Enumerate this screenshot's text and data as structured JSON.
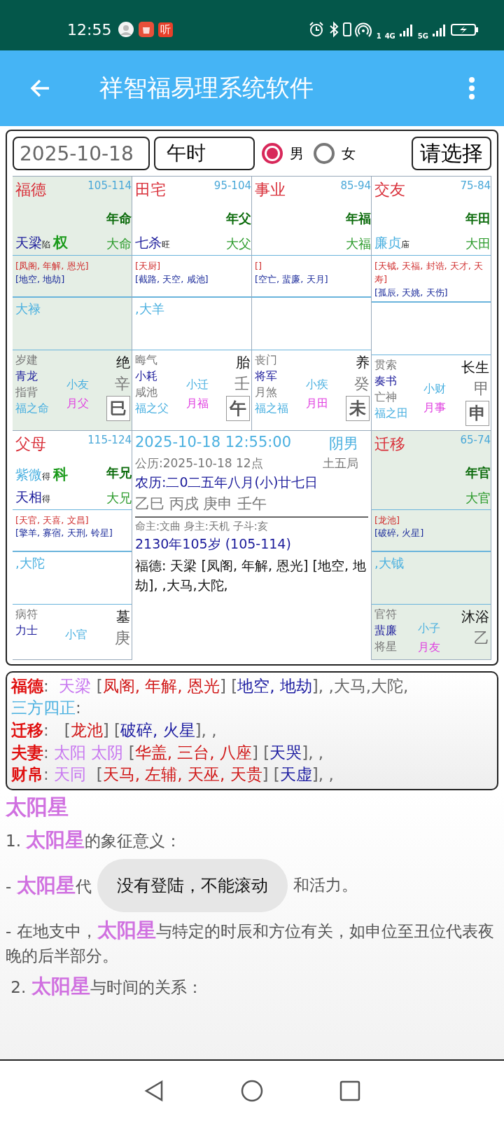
{
  "status_bar": {
    "time": "12:55",
    "app_badge": "听",
    "network_1": "4G",
    "network_2": "5G",
    "hotspot_count": "1"
  },
  "app_bar": {
    "title": "祥智福易理系统软件"
  },
  "form": {
    "date": "2025-10-18",
    "hour": "午时",
    "gender": [
      {
        "label": "男",
        "selected": true
      },
      {
        "label": "女",
        "selected": false
      }
    ],
    "button": "请选择"
  },
  "chart": {
    "palaces": [
      {
        "name": "福德",
        "range": "105-114",
        "year_tag": "年命",
        "decade_tag": "大命",
        "highlighted": true,
        "stars": [
          {
            "name": "天梁",
            "brightness": "陷",
            "hua": "权",
            "color": "#1a1a9a"
          }
        ],
        "lucky": "[凤阁, 年解, 恩光]",
        "unlucky": "[地空, 地劫]",
        "decade_stars": "大禄",
        "gods": [
          "岁建",
          "青龙",
          "指背",
          "福之命"
        ],
        "months": [
          "小友",
          "月父"
        ],
        "stage": "绝",
        "stem": "辛",
        "branch": "巳"
      },
      {
        "name": "田宅",
        "range": "95-104",
        "year_tag": "年父",
        "decade_tag": "大父",
        "highlighted": false,
        "stars": [
          {
            "name": "七杀",
            "brightness": "旺",
            "color": "#1a1a9a"
          }
        ],
        "lucky": "[天厨]",
        "unlucky": "[截路, 天空, 咸池]",
        "decade_stars": ",大羊",
        "gods": [
          "晦气",
          "小耗",
          "咸池",
          "福之父"
        ],
        "months": [
          "小迁",
          "月福"
        ],
        "stage": "胎",
        "stem": "壬",
        "branch": "午"
      },
      {
        "name": "事业",
        "range": "85-94",
        "year_tag": "年福",
        "decade_tag": "大福",
        "highlighted": false,
        "lucky": "[]",
        "unlucky": "[空亡, 蜚廉, 天月]",
        "gods": [
          "丧门",
          "将军",
          "月煞",
          "福之福"
        ],
        "months": [
          "小疾",
          "月田"
        ],
        "stage": "养",
        "stem": "癸",
        "branch": "未"
      },
      {
        "name": "交友",
        "range": "75-84",
        "year_tag": "年田",
        "decade_tag": "大田",
        "highlighted": false,
        "stars": [
          {
            "name": "廉贞",
            "brightness": "庙",
            "color": "#4ab0e0"
          }
        ],
        "lucky": "[天钺, 天福, 封诰, 天才, 天寿]",
        "unlucky": "[孤辰, 天姚, 天伤]",
        "gods": [
          "贯索",
          "奏书",
          "亡神",
          "福之田"
        ],
        "months": [
          "小财",
          "月事"
        ],
        "stage": "长生",
        "stem": "甲",
        "branch": "申"
      },
      {
        "name": "父母",
        "range": "115-124",
        "year_tag": "年兄",
        "decade_tag": "大兄",
        "highlighted": false,
        "stars": [
          {
            "name": "紫微",
            "brightness": "得",
            "hua": "科",
            "color": "#4ab0e0"
          },
          {
            "name": "天相",
            "brightness": "得",
            "color": "#1a1a9a"
          }
        ],
        "lucky": "[天官, 天喜, 文昌]",
        "unlucky": "[擎羊, 寡宿, 天刑, 铃星]",
        "decade_stars": ",大陀",
        "gods": [
          "病符",
          "力士"
        ],
        "months": [
          "小官"
        ],
        "stage": "墓",
        "stem": "庚"
      },
      {
        "name": "迁移",
        "range": "65-74",
        "year_tag": "年官",
        "decade_tag": "大官",
        "highlighted": true,
        "lucky": "[龙池]",
        "unlucky": "[破碎, 火星]",
        "decade_stars": ",大钺",
        "gods": [
          "官符",
          "蜚廉",
          "将星"
        ],
        "months": [
          "小子",
          "月友"
        ],
        "stage": "沐浴",
        "stem": "乙"
      }
    ],
    "center": {
      "datetime": "2025-10-18 12:55:00",
      "gender_label": "阴男",
      "solar": "公历:2025-10-18  12点",
      "bureau": "土五局",
      "lunar": "农历:二0二五年八月(小)廿七日",
      "ganzhi": "乙巳 丙戌 庚申 壬午",
      "masters": "命主:文曲  身主:天机  子斗:亥",
      "age": "2130年105岁 (105-114)",
      "summary": "福德:  天梁 [凤阁, 年解, 恩光] [地空, 地劫], ,大马,大陀,"
    }
  },
  "analysis": [
    [
      {
        "text": "福德",
        "kind": "palace"
      },
      {
        "text": ":  ",
        "kind": "plain"
      },
      {
        "text": "天梁",
        "kind": "main"
      },
      {
        "text": " [",
        "kind": "plain"
      },
      {
        "text": "凤阁, 年解, 恩光",
        "kind": "lucky"
      },
      {
        "text": "] [",
        "kind": "plain"
      },
      {
        "text": "地空, 地劫",
        "kind": "unlucky"
      },
      {
        "text": "], ,大马,大陀,",
        "kind": "plain"
      }
    ],
    [
      {
        "text": "三方四正",
        "kind": "heading"
      },
      {
        "text": ":",
        "kind": "plain"
      }
    ],
    [
      {
        "text": "迁移",
        "kind": "palace"
      },
      {
        "text": ":   [",
        "kind": "plain"
      },
      {
        "text": "龙池",
        "kind": "lucky"
      },
      {
        "text": "] [",
        "kind": "plain"
      },
      {
        "text": "破碎, 火星",
        "kind": "unlucky"
      },
      {
        "text": "], ,",
        "kind": "plain"
      }
    ],
    [
      {
        "text": "夫妻",
        "kind": "palace"
      },
      {
        "text": ": ",
        "kind": "plain"
      },
      {
        "text": "太阳 太阴",
        "kind": "main"
      },
      {
        "text": " [",
        "kind": "plain"
      },
      {
        "text": "华盖, 三台, 八座",
        "kind": "lucky"
      },
      {
        "text": "] [",
        "kind": "plain"
      },
      {
        "text": "天哭",
        "kind": "unlucky"
      },
      {
        "text": "], ,",
        "kind": "plain"
      }
    ],
    [
      {
        "text": "财帛",
        "kind": "palace"
      },
      {
        "text": ": ",
        "kind": "plain"
      },
      {
        "text": "天同",
        "kind": "main"
      },
      {
        "text": "  [",
        "kind": "plain"
      },
      {
        "text": "天马, 左辅, 天巫, 天贵",
        "kind": "lucky"
      },
      {
        "text": "] [",
        "kind": "plain"
      },
      {
        "text": "天虚",
        "kind": "unlucky"
      },
      {
        "text": "], ,",
        "kind": "plain"
      }
    ]
  ],
  "article": {
    "title": "太阳星",
    "lines": [
      {
        "kind": "text",
        "text": "1. **太阳星**的象征意义："
      },
      {
        "kind": "toast_row",
        "text": "- **太阳星**代",
        "toast": "没有登陆，不能滚动",
        "text_after": "和活力。"
      },
      {
        "kind": "text",
        "text": "- 在地支中，**太阳星**与特定的时辰和方位有关，如申位至丑位代表夜晚的后半部分。"
      },
      {
        "kind": "text",
        "text": " 2. **太阳星**与时间的关系："
      }
    ]
  }
}
